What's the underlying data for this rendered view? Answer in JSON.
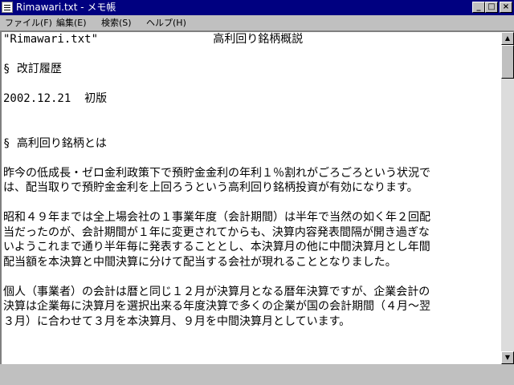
{
  "window": {
    "title": "Rimawari.txt - メモ帳",
    "controls": {
      "minimize": "_",
      "maximize": "□",
      "close": "×"
    }
  },
  "menu": [
    {
      "label": "ファイル(F)"
    },
    {
      "label": "編集(E)"
    },
    {
      "label": "検索(S)"
    },
    {
      "label": "ヘルプ(H)"
    }
  ],
  "document": {
    "lines": [
      "\"Rimawari.txt\"                 高利回り銘柄概説",
      "",
      "§ 改訂履歴",
      "",
      "2002.12.21  初版",
      "",
      "",
      "§ 高利回り銘柄とは",
      "",
      "昨今の低成長・ゼロ金利政策下で預貯金金利の年利１％割れがごろごろという状況で",
      "は、配当取りで預貯金金利を上回ろうという高利回り銘柄投資が有効になります。",
      "",
      "昭和４９年までは全上場会社の１事業年度（会計期間）は半年で当然の如く年２回配",
      "当だったのが、会計期間が１年に変更されてからも、決算内容発表間隔が開き過ぎな",
      "いようこれまで通り半年毎に発表することとし、本決算月の他に中間決算月とし年間",
      "配当額を本決算と中間決算に分けて配当する会社が現れることとなりました。",
      "",
      "個人（事業者）の会計は暦と同じ１２月が決算月となる暦年決算ですが、企業会計の",
      "決算は企業毎に決算月を選択出来る年度決算で多くの企業が国の会計期間（４月～翌",
      "３月）に合わせて３月を本決算月、９月を中間決算月としています。"
    ]
  },
  "scrollbar": {
    "up_arrow": "▲",
    "down_arrow": "▼"
  }
}
